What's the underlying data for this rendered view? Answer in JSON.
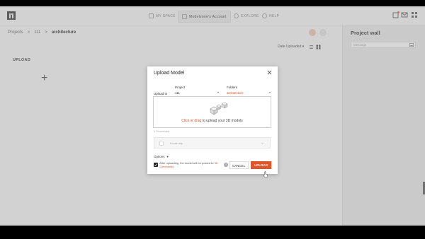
{
  "topbar": {
    "tabs": [
      {
        "label": "MY SPACE",
        "icon": "home-icon"
      },
      {
        "label": "Modelvone's Account",
        "icon": "user-icon"
      },
      {
        "label": "EXPLORE",
        "icon": "globe-icon"
      },
      {
        "label": "HELP",
        "icon": "help-icon"
      }
    ],
    "active_tab": "Modelvone's Account"
  },
  "breadcrumb": {
    "items": [
      "Projects",
      "111",
      "architecture"
    ],
    "separator": ">"
  },
  "toolbar": {
    "sort_label": "Date Uploaded"
  },
  "main": {
    "upload_label": "UPLOAD",
    "add_symbol": "+"
  },
  "project_wall": {
    "title": "Project wall",
    "message_placeholder": "Message"
  },
  "modal": {
    "title": "Upload Model",
    "upload_to_label": "Upload to",
    "project_label": "Project",
    "project_value": "111",
    "folders_label": "Folders",
    "folders_value": "architecture",
    "drop_accent": "Click or drag",
    "drop_text": " to upload your 3D models",
    "file_list_label": "1 Processed",
    "file_name": "house.skp",
    "options_label": "Options",
    "options_caret": "▾",
    "checkbox_text": "After uploading, the model will be posted to ",
    "checkbox_link": "3D Community",
    "checkbox_checked": true,
    "info_symbol": "?",
    "cancel_label": "CANCEL",
    "upload_label": "UPLOAD"
  },
  "colors": {
    "accent": "#e0552a",
    "link": "#d9542a"
  }
}
